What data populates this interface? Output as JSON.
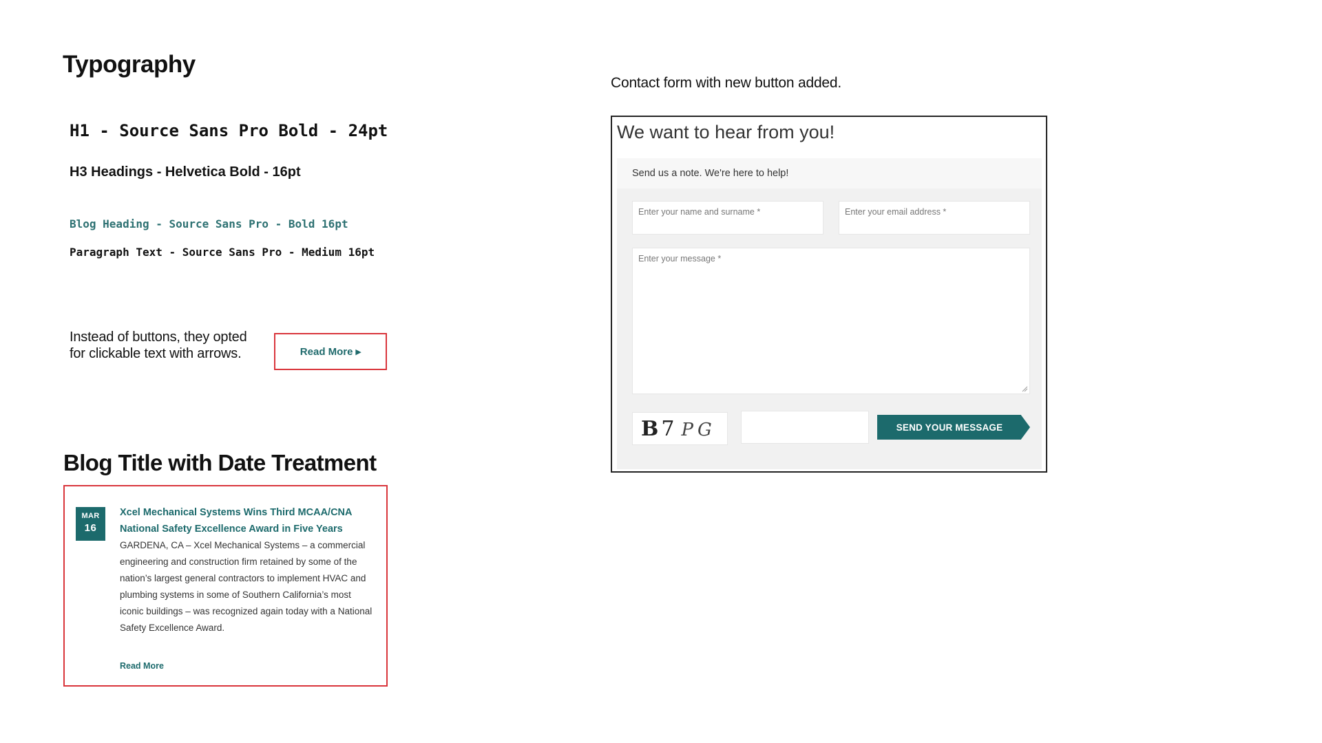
{
  "typography": {
    "title": "Typography",
    "h1_spec": "H1 - Source Sans Pro Bold - 24pt",
    "h3_spec": "H3 Headings - Helvetica Bold - 16pt",
    "blog_heading_spec": "Blog Heading - Source Sans Pro - Bold 16pt",
    "paragraph_spec": "Paragraph Text - Source Sans Pro - Medium 16pt"
  },
  "buttons": {
    "note": "Instead of buttons, they opted for clickable text with arrows.",
    "read_more_label": "Read More ▸"
  },
  "blog": {
    "section_title": "Blog Title with Date Treatment",
    "date_month": "MAR",
    "date_day": "16",
    "post_title": "Xcel Mechanical Systems Wins Third MCAA/CNA National Safety Excellence Award in Five Years",
    "post_excerpt": "GARDENA, CA – Xcel Mechanical Systems – a commercial engineering and construction firm retained by some of the nation’s largest general contractors to implement HVAC and plumbing systems in some of Southern California’s most iconic buildings – was recognized again today with a National Safety Excellence Award.",
    "read_more": "Read More"
  },
  "contact_form": {
    "caption": "Contact form with new button added.",
    "heading": "We want to hear from you!",
    "note": "Send us a note. We're here to help!",
    "name_placeholder": "Enter your name and surname *",
    "email_placeholder": "Enter your email address *",
    "message_placeholder": "Enter your message *",
    "captcha_text": "B7PG",
    "send_label": "SEND YOUR MESSAGE"
  },
  "colors": {
    "accent_teal": "#1c6a6c",
    "highlight_red": "#d9343a"
  }
}
